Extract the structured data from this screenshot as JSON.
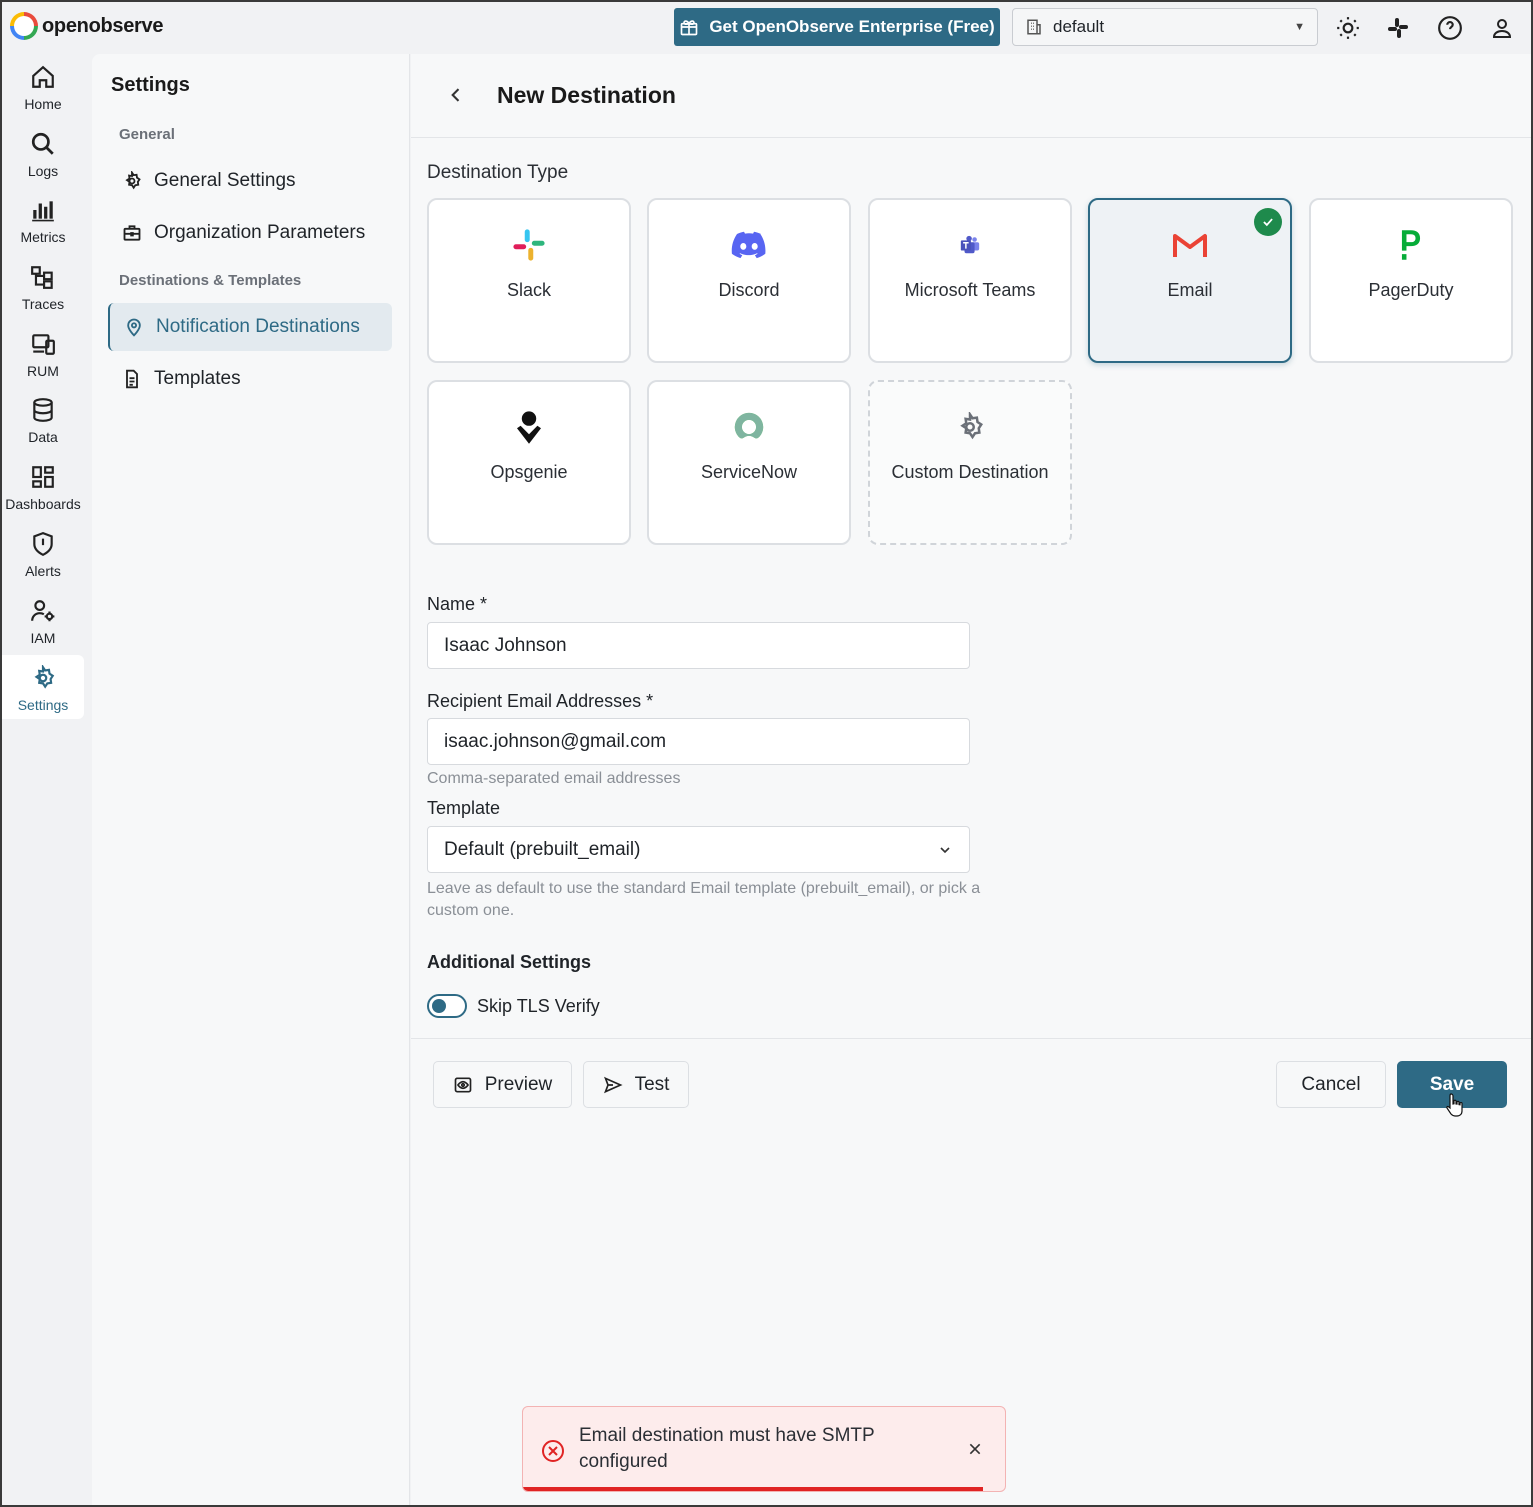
{
  "app": {
    "logo_text": "openobserve",
    "enterprise_button": "Get OpenObserve Enterprise (Free)",
    "org_selector": "default"
  },
  "leftnav": [
    {
      "label": "Home",
      "icon": "home-icon"
    },
    {
      "label": "Logs",
      "icon": "search-icon"
    },
    {
      "label": "Metrics",
      "icon": "bar-chart-icon"
    },
    {
      "label": "Traces",
      "icon": "traces-icon"
    },
    {
      "label": "RUM",
      "icon": "devices-icon"
    },
    {
      "label": "Data",
      "icon": "database-icon"
    },
    {
      "label": "Dashboards",
      "icon": "dashboard-icon"
    },
    {
      "label": "Alerts",
      "icon": "shield-alert-icon"
    },
    {
      "label": "IAM",
      "icon": "users-gear-icon"
    },
    {
      "label": "Settings",
      "icon": "gear-icon"
    }
  ],
  "settings": {
    "title": "Settings",
    "section_general": "General",
    "general_settings": "General Settings",
    "org_parameters": "Organization Parameters",
    "section_destinations": "Destinations & Templates",
    "notification_destinations": "Notification Destinations",
    "templates": "Templates"
  },
  "main": {
    "title": "New Destination",
    "destination_type_label": "Destination Type",
    "destination_types": [
      {
        "label": "Slack",
        "icon": "slack-icon"
      },
      {
        "label": "Discord",
        "icon": "discord-icon"
      },
      {
        "label": "Microsoft Teams",
        "icon": "teams-icon"
      },
      {
        "label": "Email",
        "icon": "gmail-icon",
        "selected": true
      },
      {
        "label": "PagerDuty",
        "icon": "pagerduty-icon"
      },
      {
        "label": "Opsgenie",
        "icon": "opsgenie-icon"
      },
      {
        "label": "ServiceNow",
        "icon": "servicenow-icon"
      },
      {
        "label": "Custom Destination",
        "icon": "gear-icon"
      }
    ],
    "name_label": "Name *",
    "name_value": "Isaac Johnson",
    "recipients_label": "Recipient Email Addresses *",
    "recipients_value": "isaac.johnson@gmail.com",
    "recipients_hint": "Comma-separated email addresses",
    "template_label": "Template",
    "template_value": "Default (prebuilt_email)",
    "template_hint": "Leave as default to use the standard Email template (prebuilt_email), or pick a custom one.",
    "additional_settings": "Additional Settings",
    "skip_tls_label": "Skip TLS Verify",
    "preview_button": "Preview",
    "test_button": "Test",
    "cancel_button": "Cancel",
    "save_button": "Save"
  },
  "toast": {
    "message": "Email destination must have SMTP configured"
  },
  "colors": {
    "accent": "#2e6a85",
    "success": "#1e8a4c",
    "error": "#e02424"
  }
}
